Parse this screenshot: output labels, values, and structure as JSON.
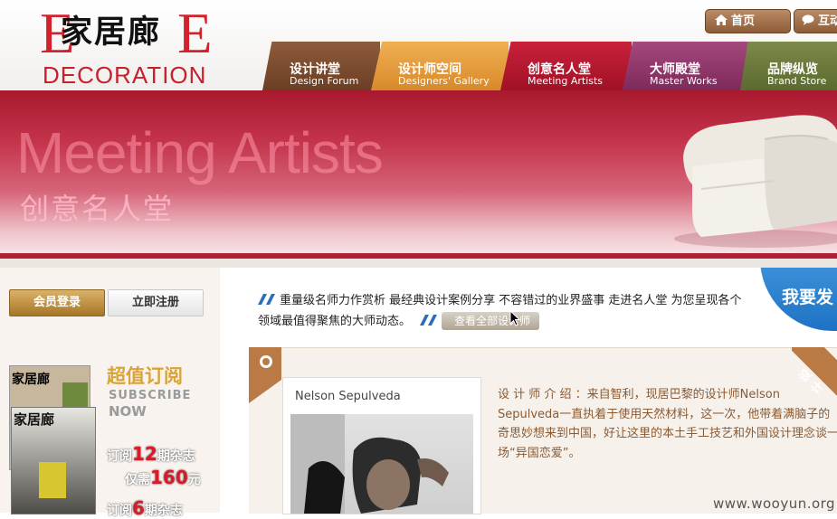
{
  "logo": {
    "cn": "家居廊",
    "dec": "DECORATION",
    "elle_letter": "E"
  },
  "top_buttons": {
    "home": "首页",
    "interact": "互动"
  },
  "nav": [
    {
      "cn": "设计讲堂",
      "en": "Design Forum"
    },
    {
      "cn": "设计师空间",
      "en": "Designers' Gallery"
    },
    {
      "cn": "创意名人堂",
      "en": "Meeting Artists"
    },
    {
      "cn": "大师殿堂",
      "en": "Master Works"
    },
    {
      "cn": "品牌纵览",
      "en": "Brand Store"
    }
  ],
  "banner": {
    "title": "Meeting Artists",
    "subtitle": "创意名人堂"
  },
  "sidebar": {
    "login": "会员登录",
    "register": "立即注册",
    "sub_title": "超值订阅",
    "sub_en1": "SUBSCRIBE",
    "sub_en2": "NOW",
    "offer1_a": "订阅",
    "offer1_num": "12",
    "offer1_b": "期杂志",
    "price_a": "仅需",
    "price_num": "160",
    "price_b": "元",
    "offer2_a": "订阅",
    "offer2_num": "6",
    "offer2_b": "期杂志",
    "mag_cn": "家居廊"
  },
  "intro": {
    "text": "重量级名师力作赏析 最经典设计案例分享 不容错过的业界盛事 走进名人堂 为您呈现各个领域最值得聚焦的大师动态。",
    "view_all": "查看全部设计师"
  },
  "corner_badge": "我要发",
  "card": {
    "name": "Nelson Sepulveda",
    "ribbon": "设计",
    "description": "设 计 师 介 绍 ：来自智利，现居巴黎的设计师Nelson Sepulveda一直执着于使用天然材料，这一次，他带着满脑子的奇思妙想来到中国，好让这里的本土手工技艺和外国设计理念谈一场“异国恋爱”。"
  },
  "watermark": "www.wooyun.org",
  "colors": {
    "brand_red": "#d2222e",
    "banner_red": "#b02033",
    "brown": "#8d5b37"
  }
}
